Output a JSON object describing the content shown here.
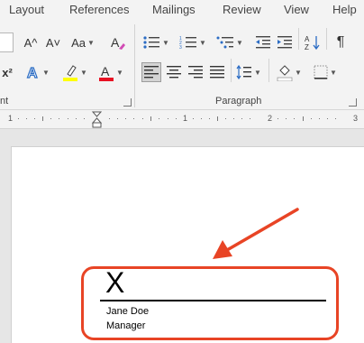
{
  "tabs": [
    "Layout",
    "References",
    "Mailings",
    "Review",
    "View",
    "Help"
  ],
  "font_group": {
    "grow_font": "A^",
    "shrink_font": "A˅",
    "change_case": "Aa",
    "superscript": "x²",
    "label": "nt"
  },
  "paragraph_group": {
    "label": "Paragraph",
    "show_marks": "¶"
  },
  "colors": {
    "highlight": "#ffff00",
    "font_color": "#e81123",
    "text_effects": "#2b6cc4",
    "annotation": "#e84425"
  },
  "ruler": {
    "numbers": [
      "1",
      "1",
      "2",
      "3"
    ]
  },
  "document": {
    "signature_mark": "X",
    "signer_name": "Jane Doe",
    "signer_title": "Manager"
  }
}
